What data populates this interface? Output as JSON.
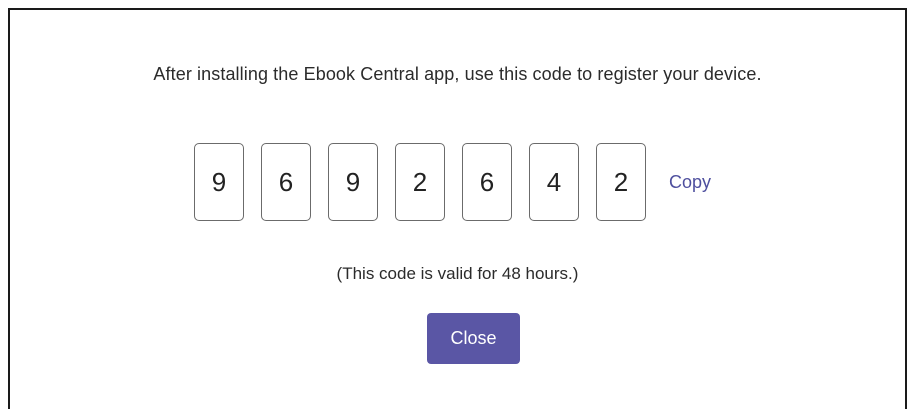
{
  "dialog": {
    "instruction": "After installing the Ebook Central app, use this code to register your device.",
    "code_digits": [
      "9",
      "6",
      "9",
      "2",
      "6",
      "4",
      "2"
    ],
    "copy_label": "Copy",
    "validity_note": "(This code is valid for 48 hours.)",
    "close_label": "Close"
  },
  "colors": {
    "accent": "#5a56a5",
    "link": "#4e4f9e",
    "border": "#1a1a1a"
  }
}
